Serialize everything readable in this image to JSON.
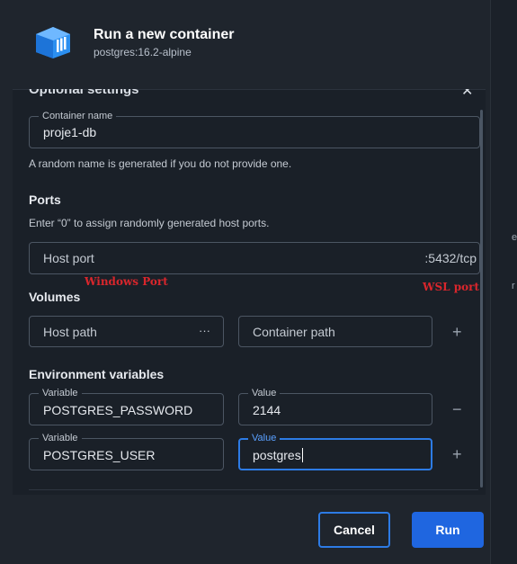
{
  "header": {
    "title": "Run a new container",
    "subtitle": "postgres:16.2-alpine"
  },
  "optional_settings": {
    "heading": "Optional settings",
    "container_name": {
      "label": "Container name",
      "value": "proje1-db",
      "help": "A random name is generated if you do not provide one."
    }
  },
  "ports": {
    "heading": "Ports",
    "help": "Enter “0” to assign randomly generated host ports.",
    "host_port_placeholder": "Host port",
    "container_port": ":5432/tcp",
    "annotation_left": "Windows Port",
    "annotation_right": "WSL port"
  },
  "volumes": {
    "heading": "Volumes",
    "host_path_placeholder": "Host path",
    "browse_label": "···",
    "container_path_placeholder": "Container path",
    "add_label": "+"
  },
  "env": {
    "heading": "Environment variables",
    "variable_label": "Variable",
    "value_label": "Value",
    "rows": [
      {
        "variable": "POSTGRES_PASSWORD",
        "value": "2144",
        "action": "−"
      },
      {
        "variable": "POSTGRES_USER",
        "value": "postgres",
        "action": "+"
      }
    ]
  },
  "footer": {
    "cancel_label": "Cancel",
    "run_label": "Run"
  },
  "side_strip": {
    "letters": [
      "e",
      "r"
    ]
  },
  "colors": {
    "accent": "#1f66e0",
    "focus_border": "#2d7be5",
    "annotation": "#d9262c",
    "background": "#1f252d"
  }
}
